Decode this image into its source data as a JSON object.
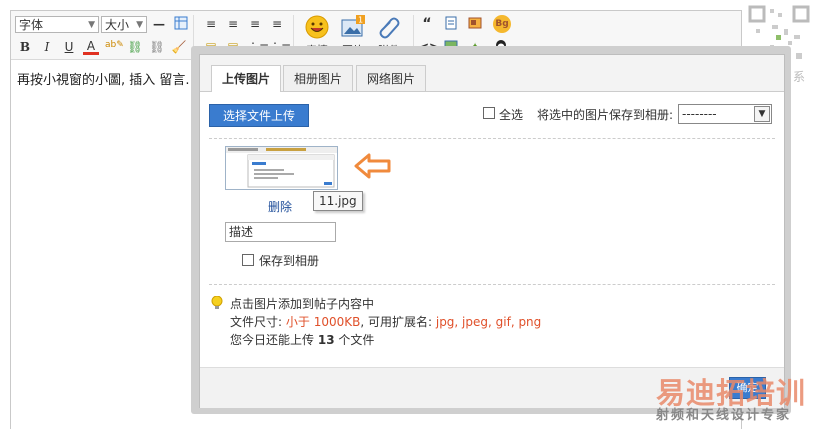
{
  "toolbar": {
    "font_select": "字体",
    "size_select": "大小",
    "buttons": [
      "B",
      "I",
      "U",
      "A"
    ],
    "big_buttons": [
      "表情",
      "图片",
      "附件"
    ],
    "quote": "“",
    "bg": "Bg",
    "code": "<>"
  },
  "editor": {
    "text": "再按小視窗的小圖, 插入 留言."
  },
  "side": {
    "contact": "微信联系"
  },
  "dialog": {
    "tabs": [
      "上传图片",
      "相册图片",
      "网络图片"
    ],
    "upload_button": "选择文件上传",
    "select_all": "全选",
    "save_to_album_label": "将选中的图片保存到相册:",
    "album_value": "--------",
    "tooltip": "11.jpg",
    "delete": "删除",
    "desc_placeholder": "描述",
    "save_checkbox": "保存到相册",
    "tips": {
      "line1": "点击图片添加到帖子内容中",
      "size_prefix": "文件尺寸:",
      "size_value": "小于 1000KB",
      "ext_prefix": ", 可用扩展名:",
      "ext_value": "jpg, jpeg, gif, png",
      "remain_prefix": "您今日还能上传",
      "remain_count": "13",
      "remain_suffix": "个文件"
    },
    "ok_button": "确定"
  },
  "watermark": {
    "main": "易迪拓培训",
    "sub": "射频和天线设计专家"
  },
  "colors": {
    "accent": "#3a7ccf",
    "highlight": "#e0502a",
    "arrow": "#f08a3c"
  }
}
